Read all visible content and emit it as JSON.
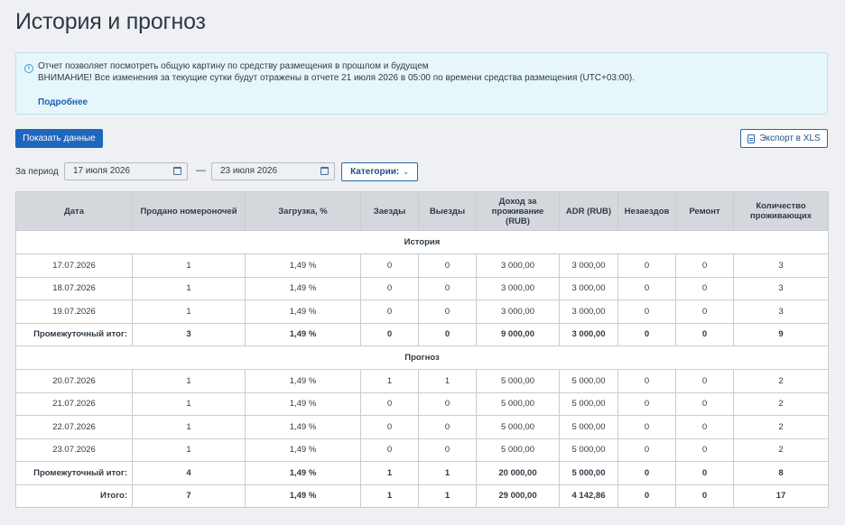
{
  "page": {
    "title": "История и прогноз"
  },
  "info": {
    "line1": "Отчет позволяет посмотреть общую картину по средству размещения в прошлом и будущем",
    "line2": "ВНИМАНИЕ! Все изменения за текущие сутки будут отражены в отчете 21 июля 2026 в 05:00 по времени средства размещения (UTC+03:00).",
    "more_link": "Подробнее",
    "icon": "info-icon",
    "icon_glyph": "i"
  },
  "toolbar": {
    "show_label": "Показать данные",
    "export_label": "Экспорт в XLS",
    "export_icon": "file-icon"
  },
  "filters": {
    "period_label": "За период",
    "date_from": "17 июля 2026",
    "date_to": "23 июля 2026",
    "separator": "—",
    "categories_label": "Категории:",
    "categories_chevron": "⌄"
  },
  "table": {
    "headers": [
      "Дата",
      "Продано номероночей",
      "Загрузка, %",
      "Заезды",
      "Выезды",
      "Доход за проживание (RUB)",
      "ADR (RUB)",
      "Незаездов",
      "Ремонт",
      "Количество проживающих"
    ],
    "rows": [
      {
        "type": "section",
        "label": "История"
      },
      {
        "type": "data",
        "cells": [
          "17.07.2026",
          "1",
          "1,49 %",
          "0",
          "0",
          "3 000,00",
          "3 000,00",
          "0",
          "0",
          "3"
        ]
      },
      {
        "type": "data",
        "cells": [
          "18.07.2026",
          "1",
          "1,49 %",
          "0",
          "0",
          "3 000,00",
          "3 000,00",
          "0",
          "0",
          "3"
        ]
      },
      {
        "type": "data",
        "cells": [
          "19.07.2026",
          "1",
          "1,49 %",
          "0",
          "0",
          "3 000,00",
          "3 000,00",
          "0",
          "0",
          "3"
        ]
      },
      {
        "type": "subtotal",
        "cells": [
          "Промежуточный итог:",
          "3",
          "1,49 %",
          "0",
          "0",
          "9 000,00",
          "3 000,00",
          "0",
          "0",
          "9"
        ]
      },
      {
        "type": "section",
        "label": "Прогноз"
      },
      {
        "type": "data",
        "cells": [
          "20.07.2026",
          "1",
          "1,49 %",
          "1",
          "1",
          "5 000,00",
          "5 000,00",
          "0",
          "0",
          "2"
        ]
      },
      {
        "type": "data",
        "cells": [
          "21.07.2026",
          "1",
          "1,49 %",
          "0",
          "0",
          "5 000,00",
          "5 000,00",
          "0",
          "0",
          "2"
        ]
      },
      {
        "type": "data",
        "cells": [
          "22.07.2026",
          "1",
          "1,49 %",
          "0",
          "0",
          "5 000,00",
          "5 000,00",
          "0",
          "0",
          "2"
        ]
      },
      {
        "type": "data",
        "cells": [
          "23.07.2026",
          "1",
          "1,49 %",
          "0",
          "0",
          "5 000,00",
          "5 000,00",
          "0",
          "0",
          "2"
        ]
      },
      {
        "type": "subtotal",
        "cells": [
          "Промежуточный итог:",
          "4",
          "1,49 %",
          "1",
          "1",
          "20 000,00",
          "5 000,00",
          "0",
          "0",
          "8"
        ]
      },
      {
        "type": "total",
        "cells": [
          "Итого:",
          "7",
          "1,49 %",
          "1",
          "1",
          "29 000,00",
          "4 142,86",
          "0",
          "0",
          "17"
        ]
      }
    ]
  },
  "colors": {
    "primary": "#1f67bd",
    "info_bg": "#e7f6fb",
    "header_bg": "#d4d8dd"
  }
}
